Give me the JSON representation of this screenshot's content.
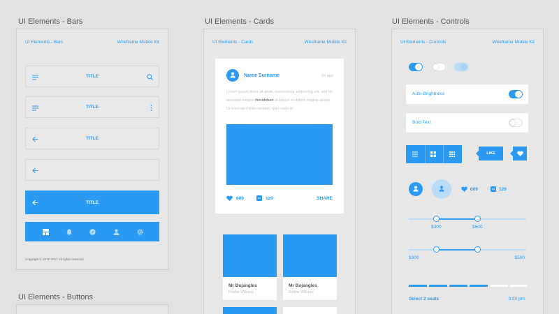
{
  "colors": {
    "accent": "#2b9af3",
    "panel_bg": "#e7e7e7",
    "page_bg": "#e2e2e2"
  },
  "bars": {
    "section_title": "UI Elements - Bars",
    "header_left": "UI Elements - Bars",
    "header_right": "Wireframe Mobile Kit",
    "bar_titles": [
      "TITLE",
      "TITLE",
      "TITLE",
      "TITLE"
    ],
    "copyright": "Copyright © 2016-2017 All rights reserved.",
    "tabbar_icons": [
      "grid-icon",
      "bell-icon",
      "compass-icon",
      "user-icon",
      "gear-icon"
    ]
  },
  "cards": {
    "section_title": "UI Elements - Cards",
    "header_left": "UI Elements - Cards",
    "header_right": "Wireframe Mobile Kit",
    "post": {
      "name": "Name Surname",
      "time": "1h ago",
      "body_before": "Lorem ipsum dolor sit amet, consectetur adipiscing elit, sed do eiusmod tempor ",
      "hashtag": "#incididunt",
      "body_after": " ut labore et dolore magna aliqua. Ut enim ad minim veniam, quis nostrud",
      "likes": "609",
      "comments": "120",
      "share": "SHARE"
    },
    "mini_cards": [
      {
        "name": "Mr Bojangles",
        "sub": "Robbie Williams"
      },
      {
        "name": "Mr Bojangles",
        "sub": "Robbie Williams"
      }
    ]
  },
  "controls": {
    "section_title": "UI Elements - Controls",
    "header_left": "UI Elements - Controls",
    "header_right": "Wireframe Mobile Kit",
    "auto_brightness": "Auto-Brightness",
    "bold_text": "Bold Text",
    "like_tooltip": "LIKE",
    "likes": "609",
    "comments": "120",
    "slider1": {
      "min_label": "$300",
      "max_label": "$500"
    },
    "slider2": {
      "min_label": "$300",
      "max_label": "$500"
    },
    "seats_label": "Select 2 seats",
    "seats_time": "9:30 pm"
  },
  "buttons": {
    "section_title": "UI Elements - Buttons"
  }
}
